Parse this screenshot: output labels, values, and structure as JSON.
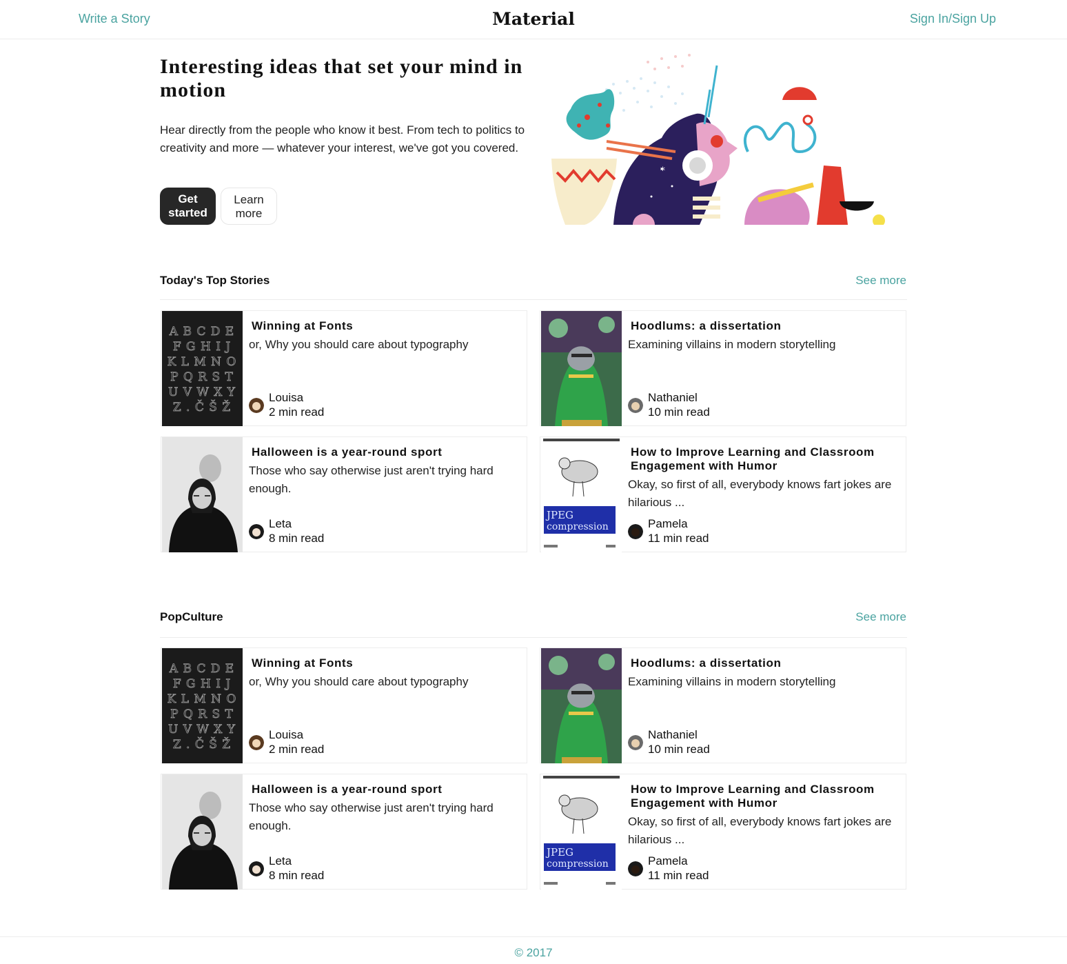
{
  "header": {
    "write_link": "Write a Story",
    "brand": "Material",
    "signin_link": "Sign In/Sign Up"
  },
  "hero": {
    "title": "Interesting ideas that set your mind in motion",
    "text": "Hear directly from the people who know it best. From tech to politics to creativity and more — whatever your interest, we've got you covered.",
    "primary_line1": "Get",
    "primary_line2": "started",
    "secondary_line1": "Learn",
    "secondary_line2": "more"
  },
  "sections": [
    {
      "title": "Today's Top Stories",
      "see_more": "See more",
      "cards": [
        {
          "title": "Winning at Fonts",
          "subtitle": "or, Why you should care about typography",
          "author": "Louisa",
          "read_time": "2 min read",
          "image": "alphabet-letters"
        },
        {
          "title": "Hoodlums: a dissertation",
          "subtitle": "Examining villains in modern storytelling",
          "author": "Nathaniel",
          "read_time": "10 min read",
          "image": "comic-villain"
        },
        {
          "title": "Halloween is a year-round sport",
          "subtitle": "Those who say otherwise just aren't trying hard enough.",
          "author": "Leta",
          "read_time": "8 min read",
          "image": "old-portrait"
        },
        {
          "title": "How to Improve Learning and Classroom Engagement with Humor",
          "subtitle": "Okay, so first of all, everybody knows fart jokes are hilarious ...",
          "author": "Pamela",
          "read_time": "11 min read",
          "image": "jpeg-compression-book"
        }
      ]
    },
    {
      "title": "PopCulture",
      "see_more": "See more",
      "cards": [
        {
          "title": "Winning at Fonts",
          "subtitle": "or, Why you should care about typography",
          "author": "Louisa",
          "read_time": "2 min read",
          "image": "alphabet-letters"
        },
        {
          "title": "Hoodlums: a dissertation",
          "subtitle": "Examining villains in modern storytelling",
          "author": "Nathaniel",
          "read_time": "10 min read",
          "image": "comic-villain"
        },
        {
          "title": "Halloween is a year-round sport",
          "subtitle": "Those who say otherwise just aren't trying hard enough.",
          "author": "Leta",
          "read_time": "8 min read",
          "image": "old-portrait"
        },
        {
          "title": "How to Improve Learning and Classroom Engagement with Humor",
          "subtitle": "Okay, so first of all, everybody knows fart jokes are hilarious ...",
          "author": "Pamela",
          "read_time": "11 min read",
          "image": "jpeg-compression-book"
        }
      ]
    }
  ],
  "thumbs": {
    "alphabet_rows": [
      "A B C D E",
      "F G H I J",
      "K L M N O",
      "P Q R S T",
      "U V W X Y",
      "Z . Č Š Ž"
    ],
    "jpeg_line1": "JPEG",
    "jpeg_line2": "compression"
  },
  "footer": {
    "copyright": "© 2017"
  },
  "colors": {
    "accent": "#4aa3a0",
    "primary_button": "#272727"
  }
}
